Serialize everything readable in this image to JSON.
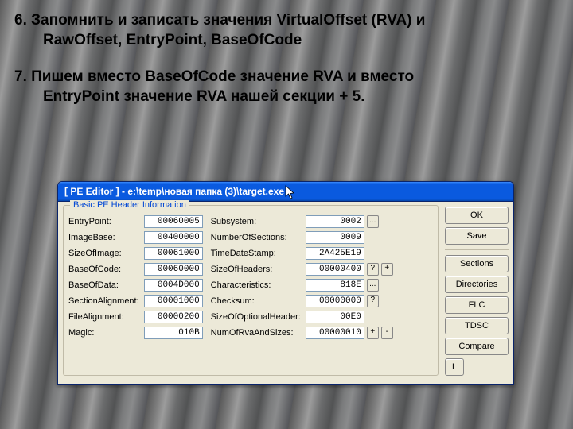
{
  "instructions": {
    "step6": {
      "line1": "6. Запомнить и записать значения VirtualOffset (RVA) и",
      "line2": "RawOffset, EntryPoint, BaseOfCode"
    },
    "step7": {
      "line1": "7. Пишем вместо BaseOfCode значение RVA и вместо",
      "line2": "EntryPoint значение RVA нашей секции + 5."
    }
  },
  "window": {
    "title": "[ PE Editor ] - e:\\temp\\новая папка (3)\\target.exe",
    "group_label": "Basic PE Header Information"
  },
  "fields": {
    "left": [
      {
        "label": "EntryPoint:",
        "value": "00060005"
      },
      {
        "label": "ImageBase:",
        "value": "00400000"
      },
      {
        "label": "SizeOfImage:",
        "value": "00061000"
      },
      {
        "label": "BaseOfCode:",
        "value": "00060000"
      },
      {
        "label": "BaseOfData:",
        "value": "0004D000"
      },
      {
        "label": "SectionAlignment:",
        "value": "00001000"
      },
      {
        "label": "FileAlignment:",
        "value": "00000200"
      },
      {
        "label": "Magic:",
        "value": "010B"
      }
    ],
    "right": [
      {
        "label": "Subsystem:",
        "value": "0002"
      },
      {
        "label": "NumberOfSections:",
        "value": "0009"
      },
      {
        "label": "TimeDateStamp:",
        "value": "2A425E19"
      },
      {
        "label": "SizeOfHeaders:",
        "value": "00000400"
      },
      {
        "label": "Characteristics:",
        "value": "818E"
      },
      {
        "label": "Checksum:",
        "value": "00000000"
      },
      {
        "label": "SizeOfOptionalHeader:",
        "value": "00E0"
      },
      {
        "label": "NumOfRvaAndSizes:",
        "value": "00000010"
      }
    ]
  },
  "buttons": {
    "ellipsis": "...",
    "query": "?",
    "plus": "+",
    "minus": "-"
  },
  "side": [
    "OK",
    "Save",
    "Sections",
    "Directories",
    "FLC",
    "TDSC",
    "Compare",
    "L"
  ]
}
